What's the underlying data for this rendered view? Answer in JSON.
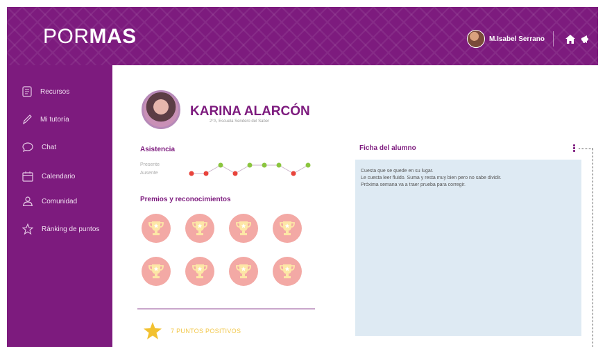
{
  "header": {
    "logo_thin": "POR",
    "logo_bold": "MAS",
    "user_name": "M.Isabel Serrano"
  },
  "sidebar": {
    "items": [
      {
        "label": "Recursos",
        "icon": "document-icon"
      },
      {
        "label": "Mi tutoría",
        "icon": "pencil-icon"
      },
      {
        "label": "Chat",
        "icon": "chat-bubble-icon"
      },
      {
        "label": "Calendario",
        "icon": "calendar-icon"
      },
      {
        "label": "Comunidad",
        "icon": "community-icon"
      },
      {
        "label": "Ránking de puntos",
        "icon": "star-icon"
      }
    ]
  },
  "student": {
    "name": "KARINA ALARCÓN",
    "school": "2°A, Escuela Sendero del Saber"
  },
  "attendance": {
    "title": "Asistencia",
    "present_label": "Presente",
    "absent_label": "Ausente",
    "series": [
      "absent",
      "absent",
      "present",
      "absent",
      "present",
      "present",
      "present",
      "absent",
      "present"
    ],
    "colors": {
      "present": "#8bc53f",
      "absent": "#e8433b"
    }
  },
  "awards": {
    "title": "Premios y reconocimientos",
    "count": 8
  },
  "points": {
    "text": "7 PUNTOS POSITIVOS"
  },
  "file": {
    "title": "Ficha del alumno",
    "lines": [
      "Cuesta que se quede en su lugar.",
      "Le cuesta leer fluido. Suma y resta muy bien pero no sabe dividir.",
      "Próxima semana va a traer prueba para corregir."
    ]
  },
  "colors": {
    "brand": "#7d1b7e",
    "trophy_bg": "#f3a9a5",
    "note_bg": "#deeaf3",
    "points_text": "#f2c84b"
  }
}
